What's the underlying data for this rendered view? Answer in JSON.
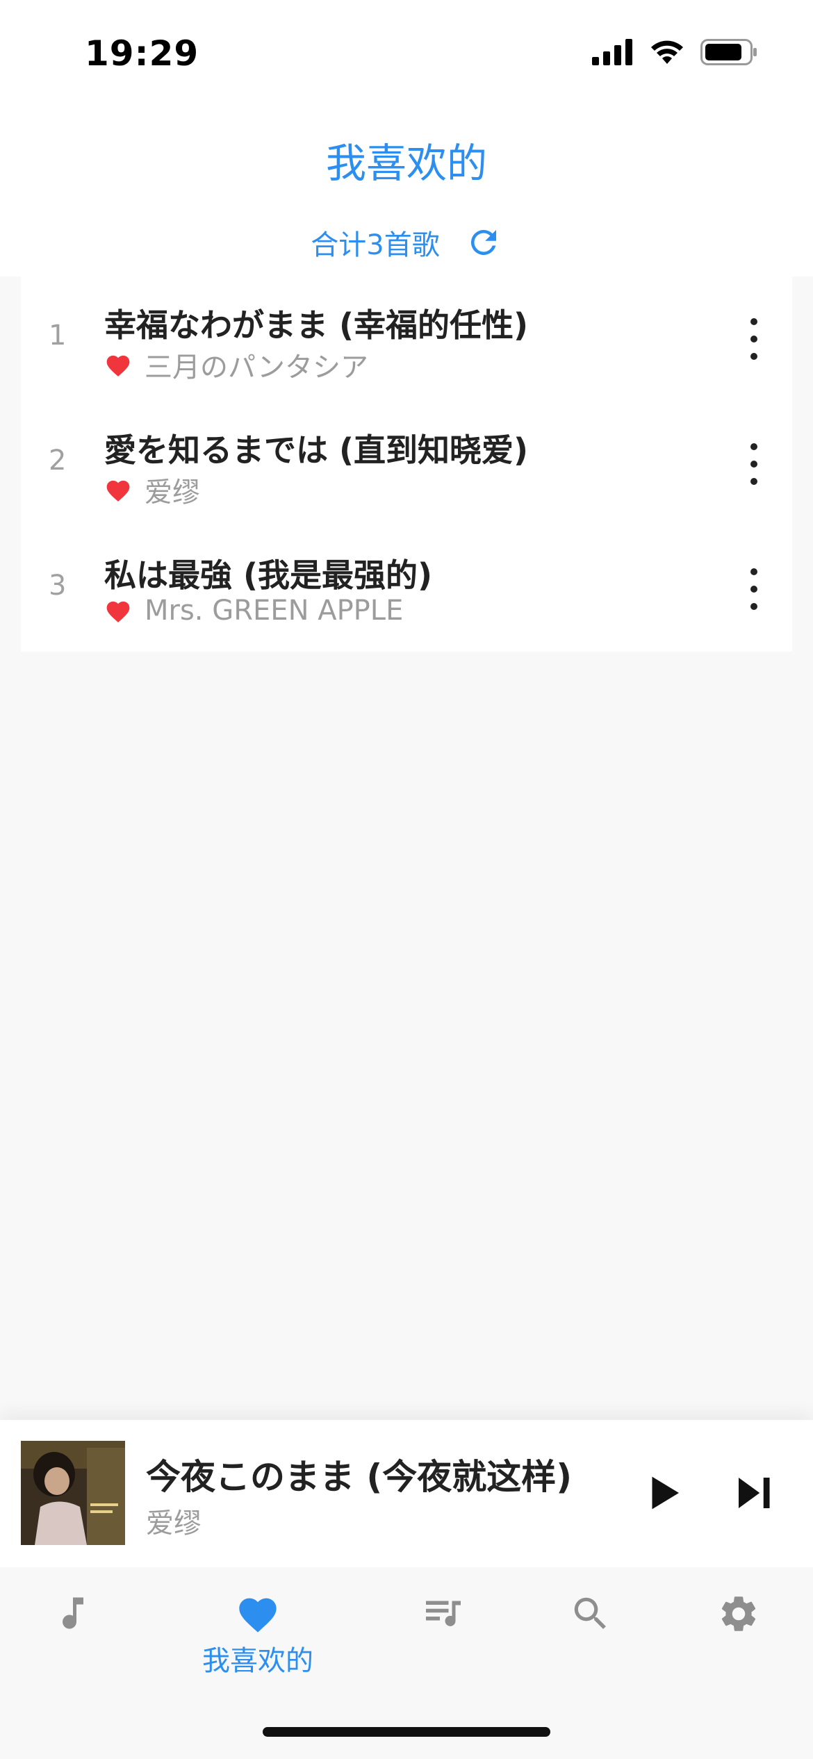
{
  "status_bar": {
    "time": "19:29"
  },
  "header": {
    "title": "我喜欢的",
    "summary": "合计3首歌"
  },
  "songs": [
    {
      "index": "1",
      "title": "幸福なわがまま (幸福的任性)",
      "artist": "三月のパンタシア",
      "liked": true
    },
    {
      "index": "2",
      "title": "愛を知るまでは (直到知晓爱)",
      "artist": "爱缪",
      "liked": true
    },
    {
      "index": "3",
      "title": "私は最強 (我是最强的)",
      "artist": "Mrs. GREEN APPLE",
      "liked": true
    }
  ],
  "now_playing": {
    "title": "今夜このまま (今夜就这样)",
    "artist": "爱缪"
  },
  "tabs": [
    {
      "icon": "music-note-icon",
      "label": ""
    },
    {
      "icon": "heart-icon",
      "label": "我喜欢的",
      "active": true
    },
    {
      "icon": "playlist-icon",
      "label": ""
    },
    {
      "icon": "search-icon",
      "label": ""
    },
    {
      "icon": "gear-icon",
      "label": ""
    }
  ],
  "colors": {
    "accent": "#2c8ff0",
    "heart": "#f0363c",
    "inactive_icon": "#8e8e8e",
    "text_primary": "#222222",
    "text_secondary": "#9c9c9c"
  }
}
